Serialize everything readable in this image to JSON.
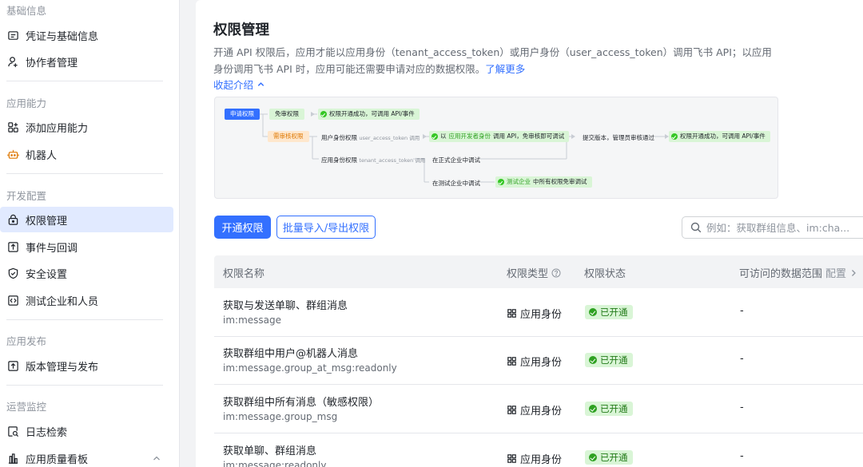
{
  "sidebar": {
    "groups": [
      {
        "title": "基础信息",
        "items": [
          {
            "label": "凭证与基础信息",
            "icon": "credential-icon"
          },
          {
            "label": "协作者管理",
            "icon": "user-add-icon"
          }
        ]
      },
      {
        "title": "应用能力",
        "items": [
          {
            "label": "添加应用能力",
            "icon": "apps-add-icon"
          },
          {
            "label": "机器人",
            "icon": "robot-icon"
          }
        ]
      },
      {
        "title": "开发配置",
        "items": [
          {
            "label": "权限管理",
            "icon": "lock-icon",
            "active": true
          },
          {
            "label": "事件与回调",
            "icon": "event-icon"
          },
          {
            "label": "安全设置",
            "icon": "shield-icon"
          },
          {
            "label": "测试企业和人员",
            "icon": "code-icon"
          }
        ]
      },
      {
        "title": "应用发布",
        "items": [
          {
            "label": "版本管理与发布",
            "icon": "upload-icon"
          }
        ]
      },
      {
        "title": "运营监控",
        "items": [
          {
            "label": "日志检索",
            "icon": "log-search-icon"
          },
          {
            "label": "应用质量看板",
            "icon": "bar-chart-icon"
          }
        ]
      }
    ]
  },
  "main": {
    "title": "权限管理",
    "description": "开通 API 权限后，应用才能以应用身份（tenant_access_token）或用户身份（user_access_token）调用飞书 API；以应用身份调用飞书 API 时，应用可能还需要申请对应的数据权限。",
    "learn_more": "了解更多",
    "collapse_label": "收起介绍",
    "flow": {
      "apply": "申请权限",
      "no_review": "免审权限",
      "open_success": "权限开通成功，可调用 API/事件",
      "need_review": "需审核权限",
      "user_perm": "用户身份权限",
      "user_token_call": "user_access_token 调用",
      "dev_identity_prefix": "以",
      "dev_identity_hl": "应用开发者身份",
      "dev_identity_suffix": "调用 API，免审核即可调试",
      "submit_review": "提交版本，管理员审核通过",
      "open_success_2": "权限开通成功，可调用 API/事件",
      "app_perm": "应用身份权限",
      "tenant_token_call": "tenant_access_token 调用",
      "formal_debug": "在正式企业中调试",
      "test_debug": "在测试企业中调试",
      "test_all_hl": "测试企业",
      "test_all_suffix": "中所有权限免审调试"
    },
    "actions": {
      "open_button": "开通权限",
      "batch_button": "批量导入/导出权限",
      "search_placeholder": "例如：获取群组信息、im:cha..."
    },
    "table": {
      "headers": {
        "name": "权限名称",
        "type": "权限类型",
        "status": "权限状态",
        "range": "可访问的数据范围",
        "config": "配置"
      },
      "rows": [
        {
          "name": "获取与发送单聊、群组消息",
          "code": "im:message",
          "type": "应用身份",
          "status": "已开通",
          "range": "-"
        },
        {
          "name": "获取群组中用户@机器人消息",
          "code": "im:message.group_at_msg:readonly",
          "type": "应用身份",
          "status": "已开通",
          "range": "-"
        },
        {
          "name": "获取群组中所有消息（敏感权限）",
          "code": "im:message.group_msg",
          "type": "应用身份",
          "status": "已开通",
          "range": "-"
        },
        {
          "name": "获取单聊、群组消息",
          "code": "im:message:readonly",
          "type": "应用身份",
          "status": "已开通",
          "range": "-"
        }
      ]
    }
  },
  "colors": {
    "accent": "#3370ff",
    "active_bg": "#e1eaff",
    "success": "#2ea121"
  }
}
